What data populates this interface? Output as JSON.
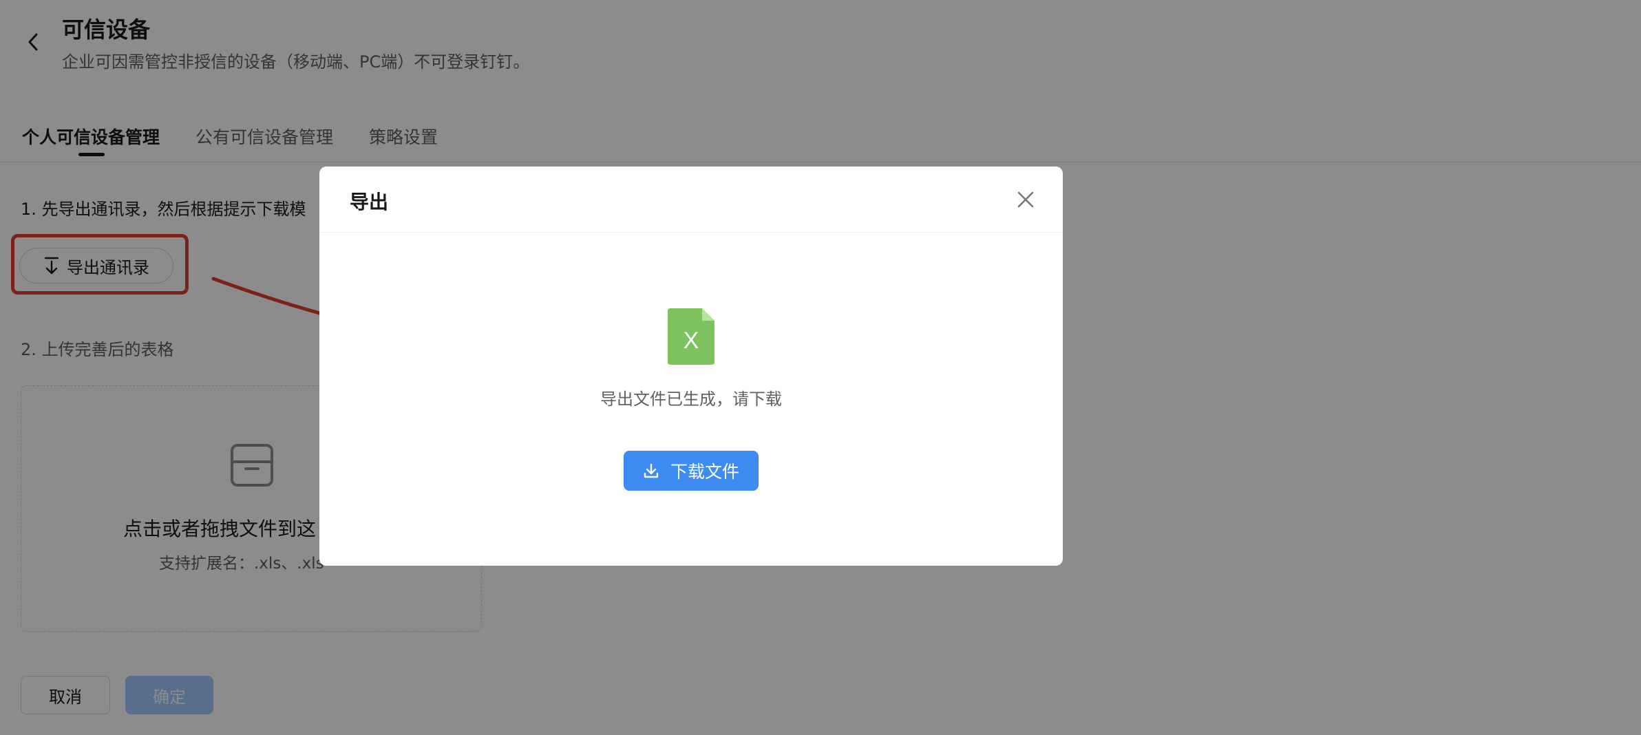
{
  "header": {
    "title": "可信设备",
    "subtitle": "企业可因需管控非授信的设备（移动端、PC端）不可登录钉钉。"
  },
  "tabs": [
    {
      "label": "个人可信设备管理",
      "active": true
    },
    {
      "label": "公有可信设备管理",
      "active": false
    },
    {
      "label": "策略设置",
      "active": false
    }
  ],
  "steps": {
    "step1": "1. 先导出通讯录，然后根据提示下载模",
    "export_button": "导出通讯录",
    "step2": "2. 上传完善后的表格",
    "upload_text": "点击或者拖拽文件到这",
    "upload_hint": "支持扩展名：.xls、.xls"
  },
  "footer": {
    "cancel_label": "取消",
    "confirm_label": "确定"
  },
  "modal": {
    "title": "导出",
    "file_icon_letter": "X",
    "message": "导出文件已生成，请下载",
    "download_label": "下载文件"
  },
  "colors": {
    "primary": "#3e8bf2",
    "excel_green": "#7cc35d",
    "highlight_red": "#e53d2f",
    "overlay": "rgba(0,0,0,0.45)"
  },
  "icons": [
    "back-arrow-icon",
    "export-download-icon",
    "archive-box-icon",
    "close-icon",
    "excel-file-icon",
    "download-icon"
  ]
}
